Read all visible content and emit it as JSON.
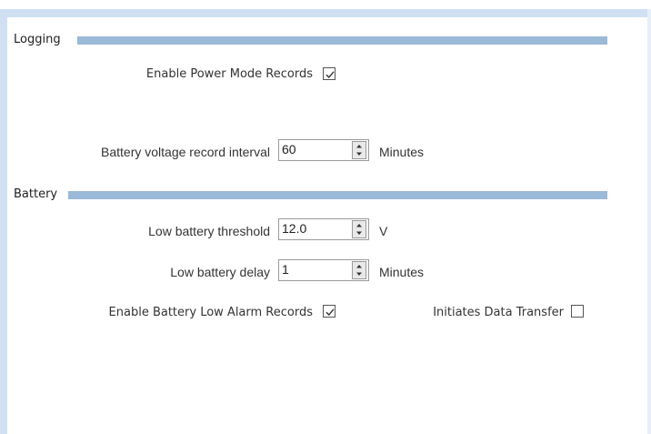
{
  "logging": {
    "title": "Logging",
    "enable_power_mode_label": "Enable Power Mode Records",
    "enable_power_mode_checked": true,
    "battery_voltage_interval_label": "Battery voltage record interval",
    "battery_voltage_interval_value": "60",
    "battery_voltage_interval_unit": "Minutes"
  },
  "battery": {
    "title": "Battery",
    "low_threshold_label": "Low battery threshold",
    "low_threshold_value": "12.0",
    "low_threshold_unit": "V",
    "low_delay_label": "Low battery delay",
    "low_delay_value": "1",
    "low_delay_unit": "Minutes",
    "enable_low_alarm_label": "Enable Battery Low Alarm Records",
    "enable_low_alarm_checked": true,
    "initiates_transfer_label": "Initiates Data Transfer",
    "initiates_transfer_checked": false
  }
}
